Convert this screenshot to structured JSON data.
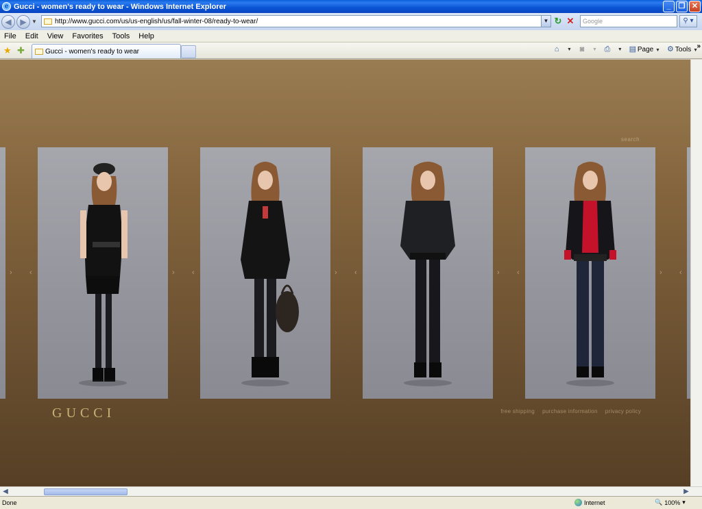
{
  "window": {
    "title": "Gucci - women's ready to wear - Windows Internet Explorer",
    "min_label": "_",
    "max_label": "❐",
    "close_label": "✕"
  },
  "address": {
    "url": "http://www.gucci.com/us/us-english/us/fall-winter-08/ready-to-wear/",
    "search_placeholder": "Google"
  },
  "menu": [
    "File",
    "Edit",
    "View",
    "Favorites",
    "Tools",
    "Help"
  ],
  "tab": {
    "label": "Gucci - women's ready to wear"
  },
  "commandbar": {
    "page_label": "Page",
    "tools_label": "Tools"
  },
  "page": {
    "search_link": "search",
    "logo_text": "GUCCI",
    "footer_links": [
      "free shipping",
      "purchase information",
      "privacy policy"
    ],
    "looks": [
      {
        "name": "look-1",
        "outfit": "black-dress"
      },
      {
        "name": "look-2",
        "outfit": "black-coat-bag"
      },
      {
        "name": "look-3",
        "outfit": "black-jacket"
      },
      {
        "name": "look-4",
        "outfit": "red-shirt-blazer"
      }
    ]
  },
  "status": {
    "left": "Done",
    "zone": "Internet",
    "zoom": "100%"
  },
  "icons": {
    "back": "back-arrow-icon",
    "forward": "forward-arrow-icon",
    "refresh": "refresh-icon",
    "stop": "stop-icon",
    "search": "magnifier-icon",
    "favorites": "star-icon",
    "add_favorite": "add-favorite-icon",
    "home": "home-icon",
    "feeds": "rss-icon",
    "print": "printer-icon"
  },
  "colors": {
    "page_top": "#9a7c52",
    "page_bottom": "#563f25",
    "logo": "#c9b177"
  }
}
